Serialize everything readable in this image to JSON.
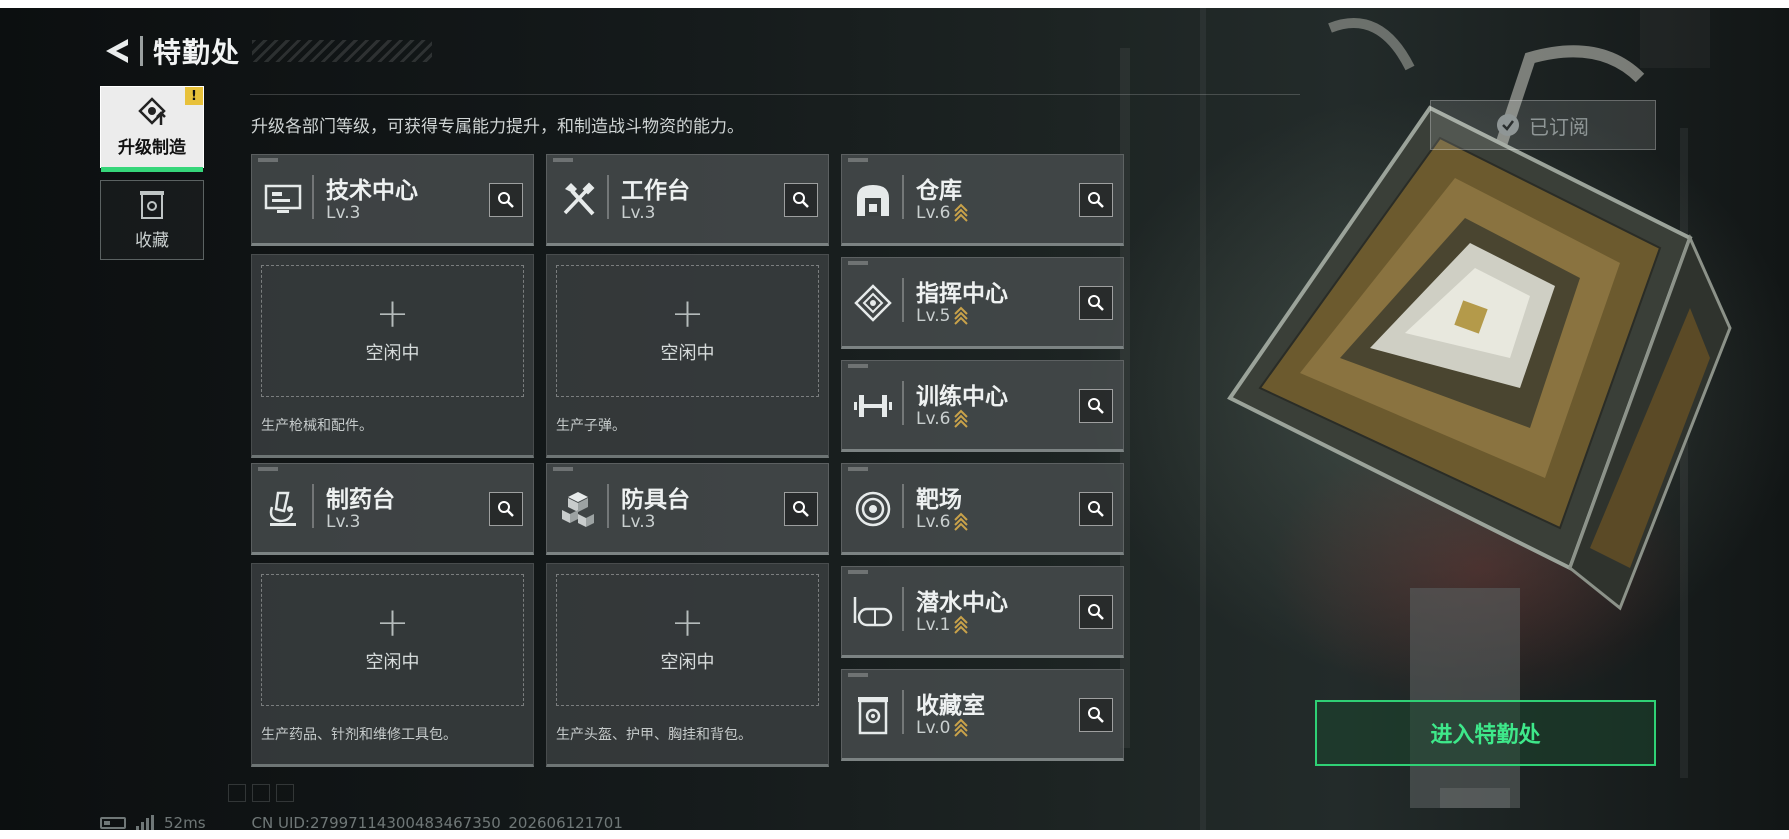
{
  "header": {
    "title": "特勤处",
    "back_icon": "back-arrow-icon"
  },
  "side_tabs": [
    {
      "label": "升级制造",
      "icon": "upgrade-craft-icon",
      "active": true,
      "badge": "!"
    },
    {
      "label": "收藏",
      "icon": "collection-icon",
      "active": false
    }
  ],
  "description": "升级各部门等级，可获得专属能力提升，和制造战斗物资的能力。",
  "subscribed_label": "已订阅",
  "production_departments": [
    {
      "name": "技术中心",
      "level": "Lv.3",
      "icon": "computer-terminal-icon",
      "slot_label": "空闲中",
      "desc": "生产枪械和配件。"
    },
    {
      "name": "工作台",
      "level": "Lv.3",
      "icon": "hammer-wrench-icon",
      "slot_label": "空闲中",
      "desc": "生产子弹。"
    },
    {
      "name": "制药台",
      "level": "Lv.3",
      "icon": "microscope-icon",
      "slot_label": "空闲中",
      "desc": "生产药品、针剂和维修工具包。"
    },
    {
      "name": "防具台",
      "level": "Lv.3",
      "icon": "armor-crates-icon",
      "slot_label": "空闲中",
      "desc": "生产头盔、护甲、胸挂和背包。"
    }
  ],
  "other_departments": [
    {
      "name": "仓库",
      "level": "Lv.6",
      "icon": "warehouse-icon"
    },
    {
      "name": "指挥中心",
      "level": "Lv.5",
      "icon": "command-center-icon"
    },
    {
      "name": "训练中心",
      "level": "Lv.6",
      "icon": "dumbbell-icon"
    },
    {
      "name": "靶场",
      "level": "Lv.6",
      "icon": "target-icon"
    },
    {
      "name": "潜水中心",
      "level": "Lv.1",
      "icon": "diving-goggles-icon"
    },
    {
      "name": "收藏室",
      "level": "Lv.0",
      "icon": "collection-room-icon"
    }
  ],
  "enter_button": "进入特勤处",
  "footer": {
    "ping": "52ms",
    "uid": "CN UID:27997114300483467350_202606121701"
  },
  "colors": {
    "accent_green": "#2fd175",
    "badge_yellow": "#e8c13a",
    "upgrade_arrow": "#c9a24a"
  }
}
